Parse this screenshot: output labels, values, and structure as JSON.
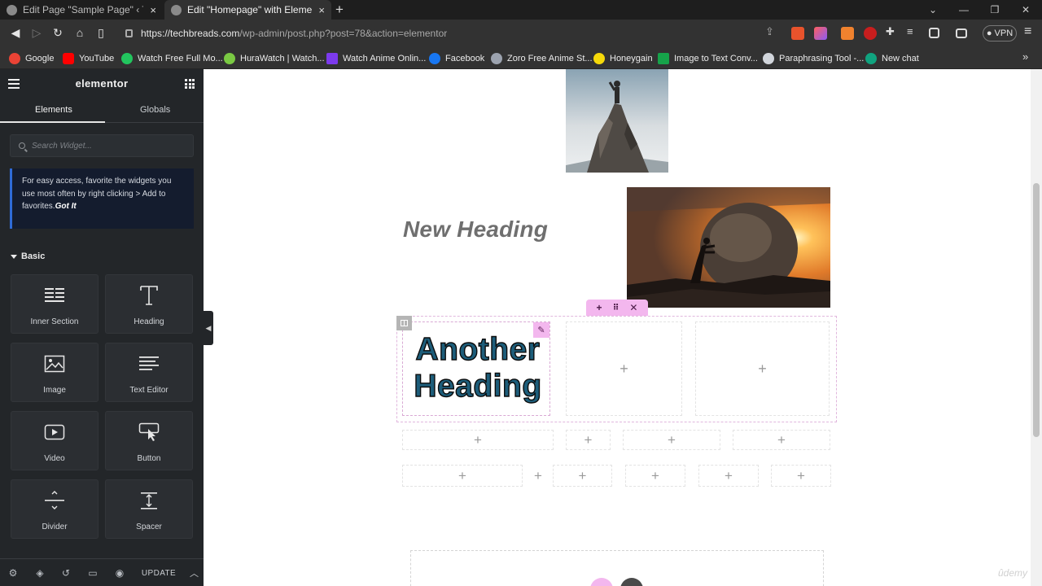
{
  "browser": {
    "tabs": [
      {
        "title": "Edit Page \"Sample Page\" ‹ The Adona",
        "active": false
      },
      {
        "title": "Edit \"Homepage\" with Elementor",
        "active": true
      }
    ],
    "url_domain": "https://techbreads.com",
    "url_path": "/wp-admin/post.php?post=78&action=elementor",
    "vpn_label": "VPN",
    "bookmarks": [
      {
        "label": "Google",
        "color": "#ea4335"
      },
      {
        "label": "YouTube",
        "color": "#ff0000"
      },
      {
        "label": "Watch Free Full Mo...",
        "color": "#22c55e"
      },
      {
        "label": "HuraWatch | Watch...",
        "color": "#7ac943"
      },
      {
        "label": "Watch Anime Onlin...",
        "color": "#7c3aed"
      },
      {
        "label": "Facebook",
        "color": "#1877f2"
      },
      {
        "label": "Zoro Free Anime St...",
        "color": "#9ca3af"
      },
      {
        "label": "Honeygain",
        "color": "#f5d90a"
      },
      {
        "label": "Image to Text Conv...",
        "color": "#16a34a"
      },
      {
        "label": "Paraphrasing Tool -...",
        "color": "#d1d5db"
      },
      {
        "label": "New chat",
        "color": "#10a37f"
      }
    ]
  },
  "panel": {
    "logo": "elementor",
    "tabs": {
      "elements": "Elements",
      "globals": "Globals"
    },
    "search_placeholder": "Search Widget...",
    "tip_text": "For easy access, favorite the widgets you use most often by right clicking > Add to favorites.",
    "tip_link": "Got It",
    "section_title": "Basic",
    "widgets": [
      {
        "label": "Inner Section",
        "icon": "inner-section-icon"
      },
      {
        "label": "Heading",
        "icon": "heading-icon"
      },
      {
        "label": "Image",
        "icon": "image-icon"
      },
      {
        "label": "Text Editor",
        "icon": "text-editor-icon"
      },
      {
        "label": "Video",
        "icon": "video-icon"
      },
      {
        "label": "Button",
        "icon": "button-icon"
      },
      {
        "label": "Divider",
        "icon": "divider-icon"
      },
      {
        "label": "Spacer",
        "icon": "spacer-icon"
      }
    ],
    "update_label": "UPDATE"
  },
  "canvas": {
    "new_heading": "New Heading",
    "another_heading": "Another Heading",
    "accent_color": "#f3b7ee",
    "heading_color": "#1d5d7a"
  }
}
